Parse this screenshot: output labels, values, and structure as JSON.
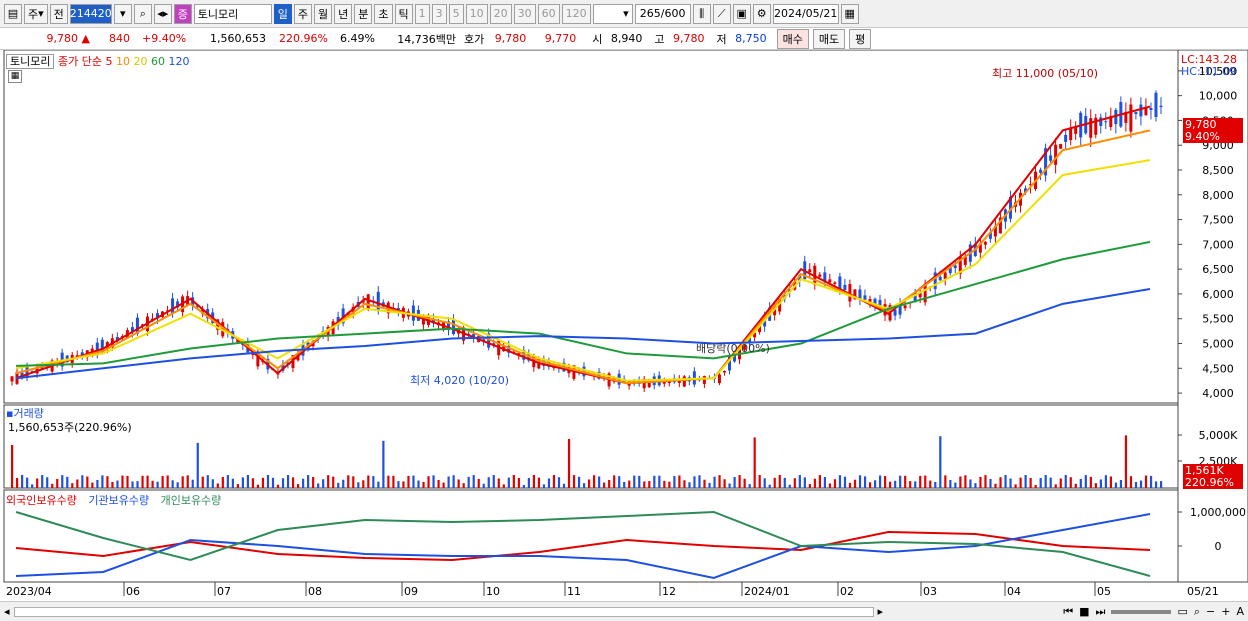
{
  "toolbar": {
    "market": "주",
    "prev": "전",
    "code": "214420",
    "name": "토니모리",
    "periods": [
      "일",
      "주",
      "월",
      "년",
      "분",
      "초",
      "틱"
    ],
    "intervals": [
      "1",
      "3",
      "5",
      "10",
      "20",
      "30",
      "60",
      "120"
    ],
    "count": "265",
    "count_total": "/600",
    "date": "2024/05/21",
    "stock_badge": "증"
  },
  "quote": {
    "price": "9,780",
    "arrow": "▲",
    "change": "840",
    "rate": "+9.40%",
    "volume": "1,560,653",
    "vol_ratio": "220.96%",
    "turnover": "6.49%",
    "amount": "14,736백만",
    "hoga_label": "호가",
    "ask": "9,780",
    "bid": "9,770",
    "open_label": "시",
    "open": "8,940",
    "high_label": "고",
    "high": "9,780",
    "low_label": "저",
    "low": "8,750",
    "buy": "매수",
    "sell": "매도",
    "eval": "평"
  },
  "price_panel": {
    "name": "토니모리",
    "ma_label": "종가 단순",
    "ma_periods": [
      "5",
      "10",
      "20",
      "60",
      "120"
    ],
    "ma_colors": [
      "#e00000",
      "#ff8c00",
      "#f0e000",
      "#1f9a3a",
      "#1e50e0"
    ],
    "lc": "LC:143.28",
    "hc": "HC:-11.09",
    "y_ticks": [
      "10,500",
      "10,000",
      "9,500",
      "9,000",
      "8,500",
      "8,000",
      "7,500",
      "7,000",
      "6,500",
      "6,000",
      "5,500",
      "5,000",
      "4,500",
      "4,000"
    ],
    "current_price": "9,780",
    "current_rate": "9.40%",
    "high_note": "최고 11,000 (05/10)",
    "low_note": "최저 4,020 (10/20)",
    "dividend_note": "배당락(0.00%)"
  },
  "volume_panel": {
    "title": "거래량",
    "value": "1,560,653주(220.96%)",
    "y_ticks": [
      "5,000K",
      "2,500K"
    ],
    "current": "1,561K",
    "current_rate": "220.96%"
  },
  "holding_panel": {
    "legend": [
      "외국인보유수량",
      "기관보유수량",
      "개인보유수량"
    ],
    "colors": [
      "#e00000",
      "#1e50e0",
      "#2e8b57"
    ],
    "y_ticks": [
      "1,000,000",
      "0"
    ]
  },
  "x_axis": {
    "labels": [
      "2023/04",
      "06",
      "07",
      "08",
      "09",
      "10",
      "11",
      "12",
      "2024/01",
      "02",
      "03",
      "04",
      "05",
      "05/21"
    ]
  },
  "chart_data": {
    "type": "line",
    "title": "토니모리",
    "x": [
      "2023/04",
      "06",
      "07",
      "08",
      "09",
      "10",
      "11",
      "12",
      "2024/01",
      "02",
      "03",
      "04",
      "05",
      "05/21"
    ],
    "series": [
      {
        "name": "5",
        "values": [
          4300,
          4900,
          5900,
          4400,
          5900,
          5300,
          4600,
          4200,
          4300,
          6500,
          5600,
          7000,
          9300,
          9780
        ]
      },
      {
        "name": "10",
        "values": [
          4400,
          4850,
          5800,
          4500,
          5800,
          5400,
          4650,
          4200,
          4300,
          6400,
          5650,
          6900,
          8900,
          9300
        ]
      },
      {
        "name": "20",
        "values": [
          4500,
          4800,
          5600,
          4700,
          5700,
          5500,
          4700,
          4250,
          4300,
          6300,
          5700,
          6600,
          8400,
          8700
        ]
      },
      {
        "name": "60",
        "values": [
          4550,
          4600,
          4900,
          5100,
          5200,
          5300,
          5200,
          4800,
          4700,
          5000,
          5700,
          6200,
          6700,
          7050
        ]
      },
      {
        "name": "120",
        "values": [
          4300,
          4500,
          4700,
          4850,
          4950,
          5100,
          5150,
          5100,
          5000,
          5050,
          5100,
          5200,
          5800,
          6100
        ]
      }
    ],
    "ylim": [
      3800,
      10800
    ],
    "annotations": [
      "최고 11,000 (05/10)",
      "최저 4,020 (10/20)",
      "배당락(0.00%)"
    ]
  }
}
